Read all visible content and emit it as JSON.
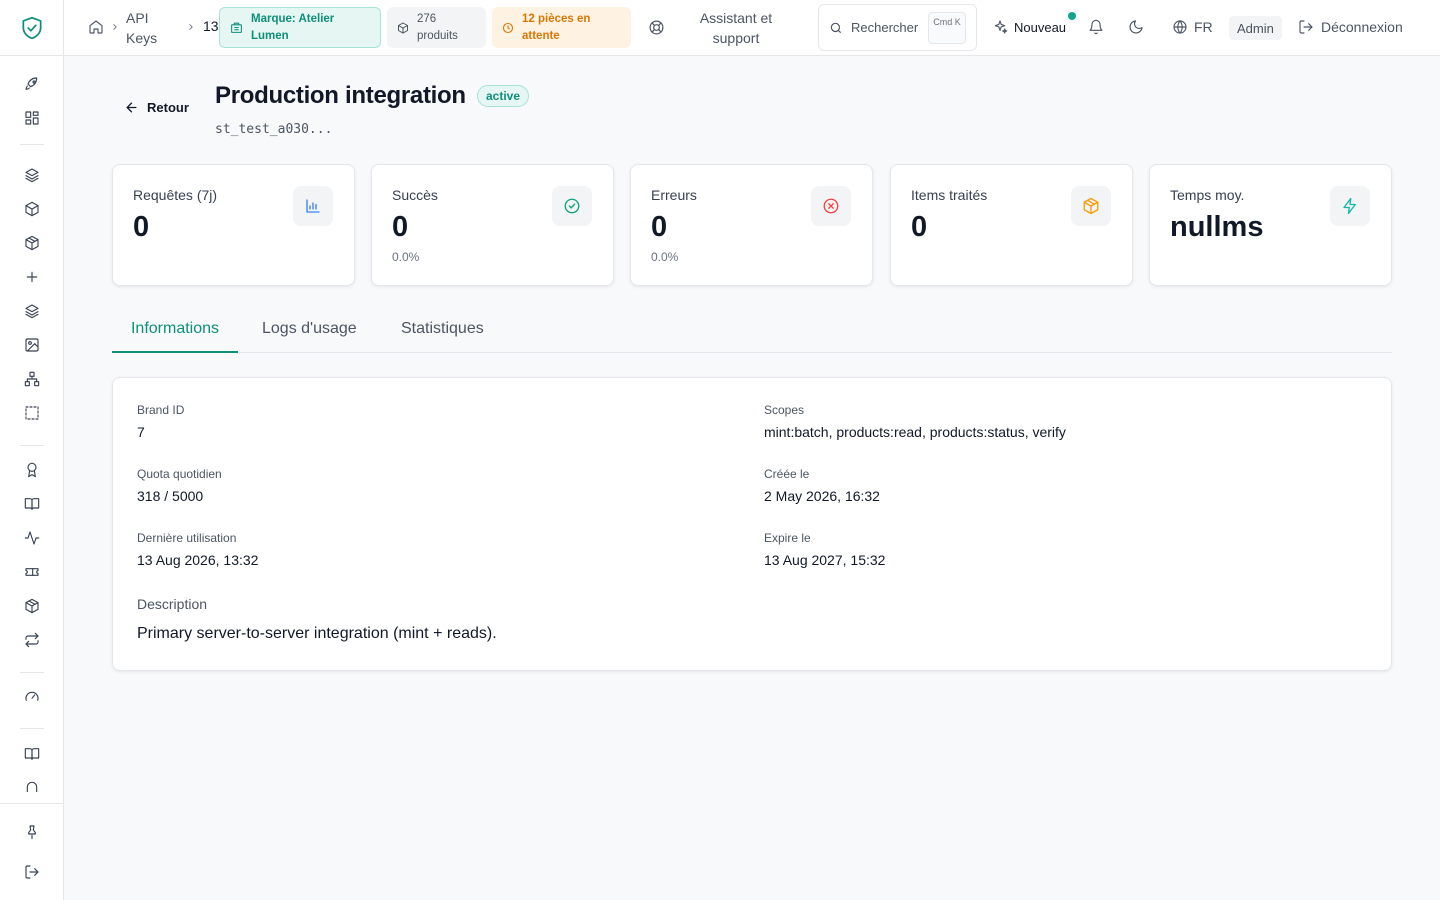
{
  "topbar": {
    "breadcrumb_section": "API Keys",
    "breadcrumb_current": "13",
    "brand_pill": "Marque: Atelier Lumen",
    "products_pill": "276 produits",
    "pending_pill": "12 pièces en attente",
    "support_label": "Assistant et support",
    "search_placeholder": "Rechercher",
    "search_kbd": "Cmd K",
    "new_label": "Nouveau",
    "lang_label": "FR",
    "role_badge": "Admin",
    "logout_label": "Déconnexion"
  },
  "header": {
    "back_label": "Retour",
    "title": "Production integration",
    "status": "active",
    "key_prefix": "st_test_a030..."
  },
  "stats": [
    {
      "label": "Requêtes (7j)",
      "value": "0",
      "sub": "",
      "icon": "bar-chart-icon",
      "color": "#3b82f6"
    },
    {
      "label": "Succès",
      "value": "0",
      "sub": "0.0%",
      "icon": "check-circle-icon",
      "color": "#10a37f"
    },
    {
      "label": "Erreurs",
      "value": "0",
      "sub": "0.0%",
      "icon": "x-circle-icon",
      "color": "#ef4444"
    },
    {
      "label": "Items traités",
      "value": "0",
      "sub": "",
      "icon": "package-icon",
      "color": "#f59e0b"
    },
    {
      "label": "Temps moy.",
      "value": "nullms",
      "sub": "",
      "icon": "zap-icon",
      "color": "#14b8a6"
    }
  ],
  "tabs": [
    {
      "label": "Informations",
      "active": true
    },
    {
      "label": "Logs d'usage",
      "active": false
    },
    {
      "label": "Statistiques",
      "active": false
    }
  ],
  "info": {
    "brand_id_label": "Brand ID",
    "brand_id": "7",
    "scopes_label": "Scopes",
    "scopes": "mint:batch, products:read, products:status, verify",
    "quota_label": "Quota quotidien",
    "quota": "318 / 5000",
    "created_label": "Créée le",
    "created": "2 May 2026, 16:32",
    "last_used_label": "Dernière utilisation",
    "last_used": "13 Aug 2026, 13:32",
    "expires_label": "Expire le",
    "expires": "13 Aug 2027, 15:32",
    "description_label": "Description",
    "description": "Primary server-to-server integration (mint + reads)."
  },
  "colors": {
    "accent": "#0f8f7a",
    "accent_bg": "#e6f6f3",
    "warning": "#d97706",
    "notification_dot": "#14a38b"
  }
}
